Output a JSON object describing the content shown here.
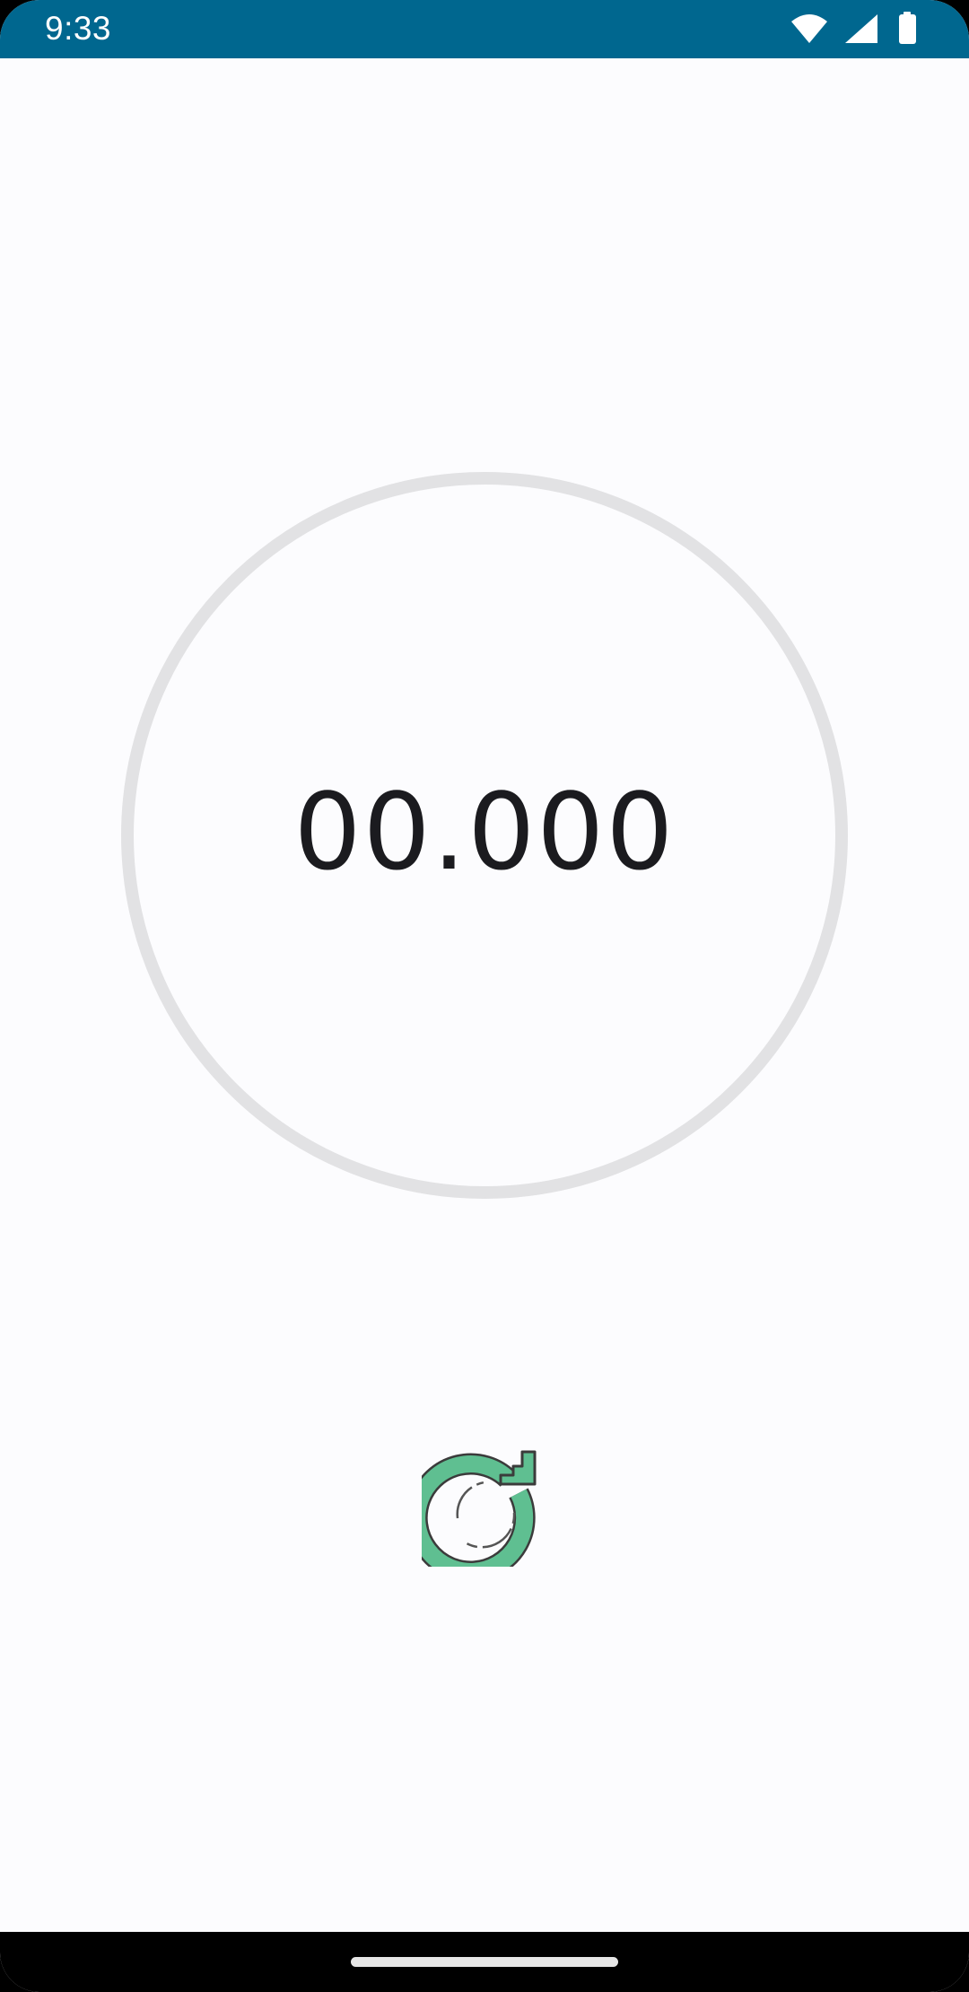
{
  "status_bar": {
    "time": "9:33",
    "background": "#00678f",
    "icons": [
      "wifi-icon",
      "cellular-signal-icon",
      "battery-icon"
    ]
  },
  "timer": {
    "display": "00.000"
  },
  "controls": {
    "reset_icon": "refresh-icon",
    "reset_accent": "#5fbf91"
  },
  "nav_bar": {
    "handle": "home-gesture-handle"
  }
}
